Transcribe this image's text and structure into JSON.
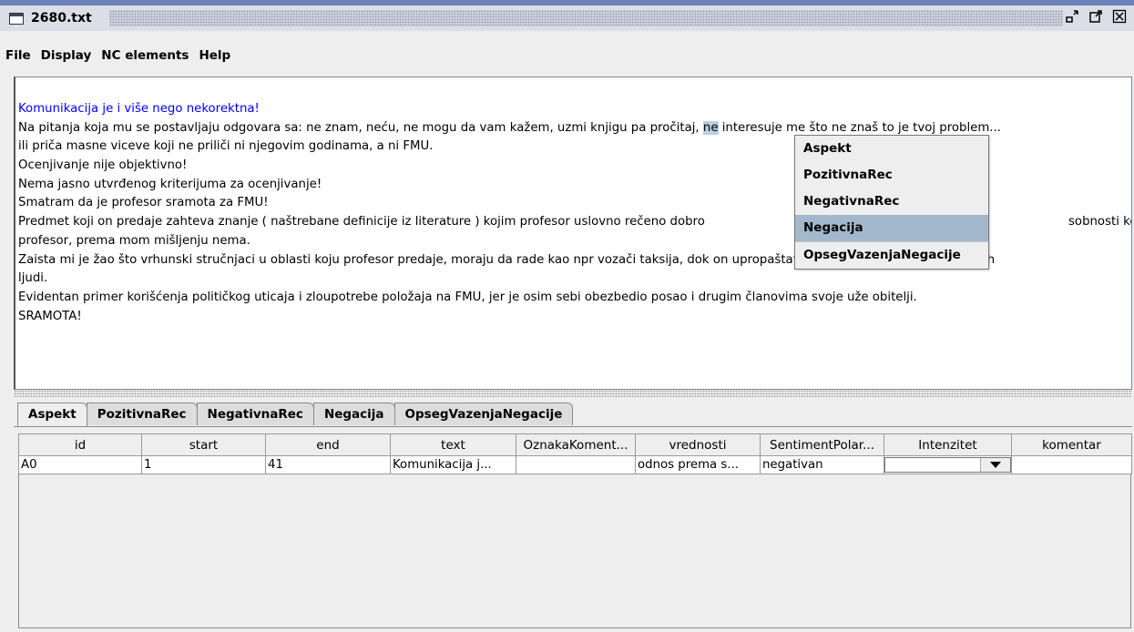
{
  "window": {
    "title": "2680.txt",
    "icons": {
      "app": "window-icon",
      "iconify": "iconify-icon",
      "maximize": "maximize-icon",
      "close": "close-icon"
    }
  },
  "menubar": [
    "File",
    "Display",
    "NC elements",
    "Help"
  ],
  "document": {
    "lines": [
      "Komunikacija je i više nego nekorektna!",
      "Na pitanja koja mu se postavljaju odgovara sa: ne znam, neću, ne mogu da vam kažem, uzmi knjigu pa pročitaj, ",
      "ili priča masne viceve koji ne priliči ni njegovim godinama, a ni FMU.",
      "Ocenjivanje nije objektivno!",
      "Nema jasno utvrđenog kriterijuma za ocenjivanje!",
      "Smatram da je profesor sramota za FMU!",
      "Predmet koji on predaje zahteva znanje ( naštrebane definicije iz literature ) kojim profesor uslovno rečeno dobro ",
      "profesor, prema mom mišljenju nema.",
      "Zaista mi je žao što vrhunski stručnjaci u oblasti koju profesor predaje, moraju da rade kao npr vozači taksija, dok on upropaštava generacije i generacije mladih",
      "ljudi.",
      "Evidentan primer korišćenja političkog uticaja i zloupotrebe položaja na FMU, jer je osim sebi obezbedio posao i drugim članovima svoje uže obitelji.",
      "SRAMOTA!"
    ],
    "line2_selected": "ne",
    "line2_rest": " interesuje me što ne znaš to je tvoj problem...",
    "line7_rest": "sobnosti koje"
  },
  "popup": {
    "items": [
      "Aspekt",
      "PozitivnaRec",
      "NegativnaRec",
      "Negacija",
      "OpsegVazenjaNegacije"
    ],
    "selected_index": 3
  },
  "tabs": [
    "Aspekt",
    "PozitivnaRec",
    "NegativnaRec",
    "Negacija",
    "OpsegVazenjaNegacije"
  ],
  "active_tab": "Aspekt",
  "table": {
    "columns": [
      "id",
      "start",
      "end",
      "text",
      "OznakaKoment...",
      "vrednosti",
      "SentimentPolar...",
      "Intenzitet",
      "komentar"
    ],
    "rows": [
      [
        "A0",
        "1",
        "41",
        "Komunikacija j...",
        "",
        "odnos prema s...",
        "negativan",
        "",
        ""
      ]
    ]
  },
  "colors": {
    "title_bar": "#dcdee7",
    "title_accent": "#6c82b6",
    "selection": "#a3b8cc",
    "blue_text": "#0000ff"
  }
}
